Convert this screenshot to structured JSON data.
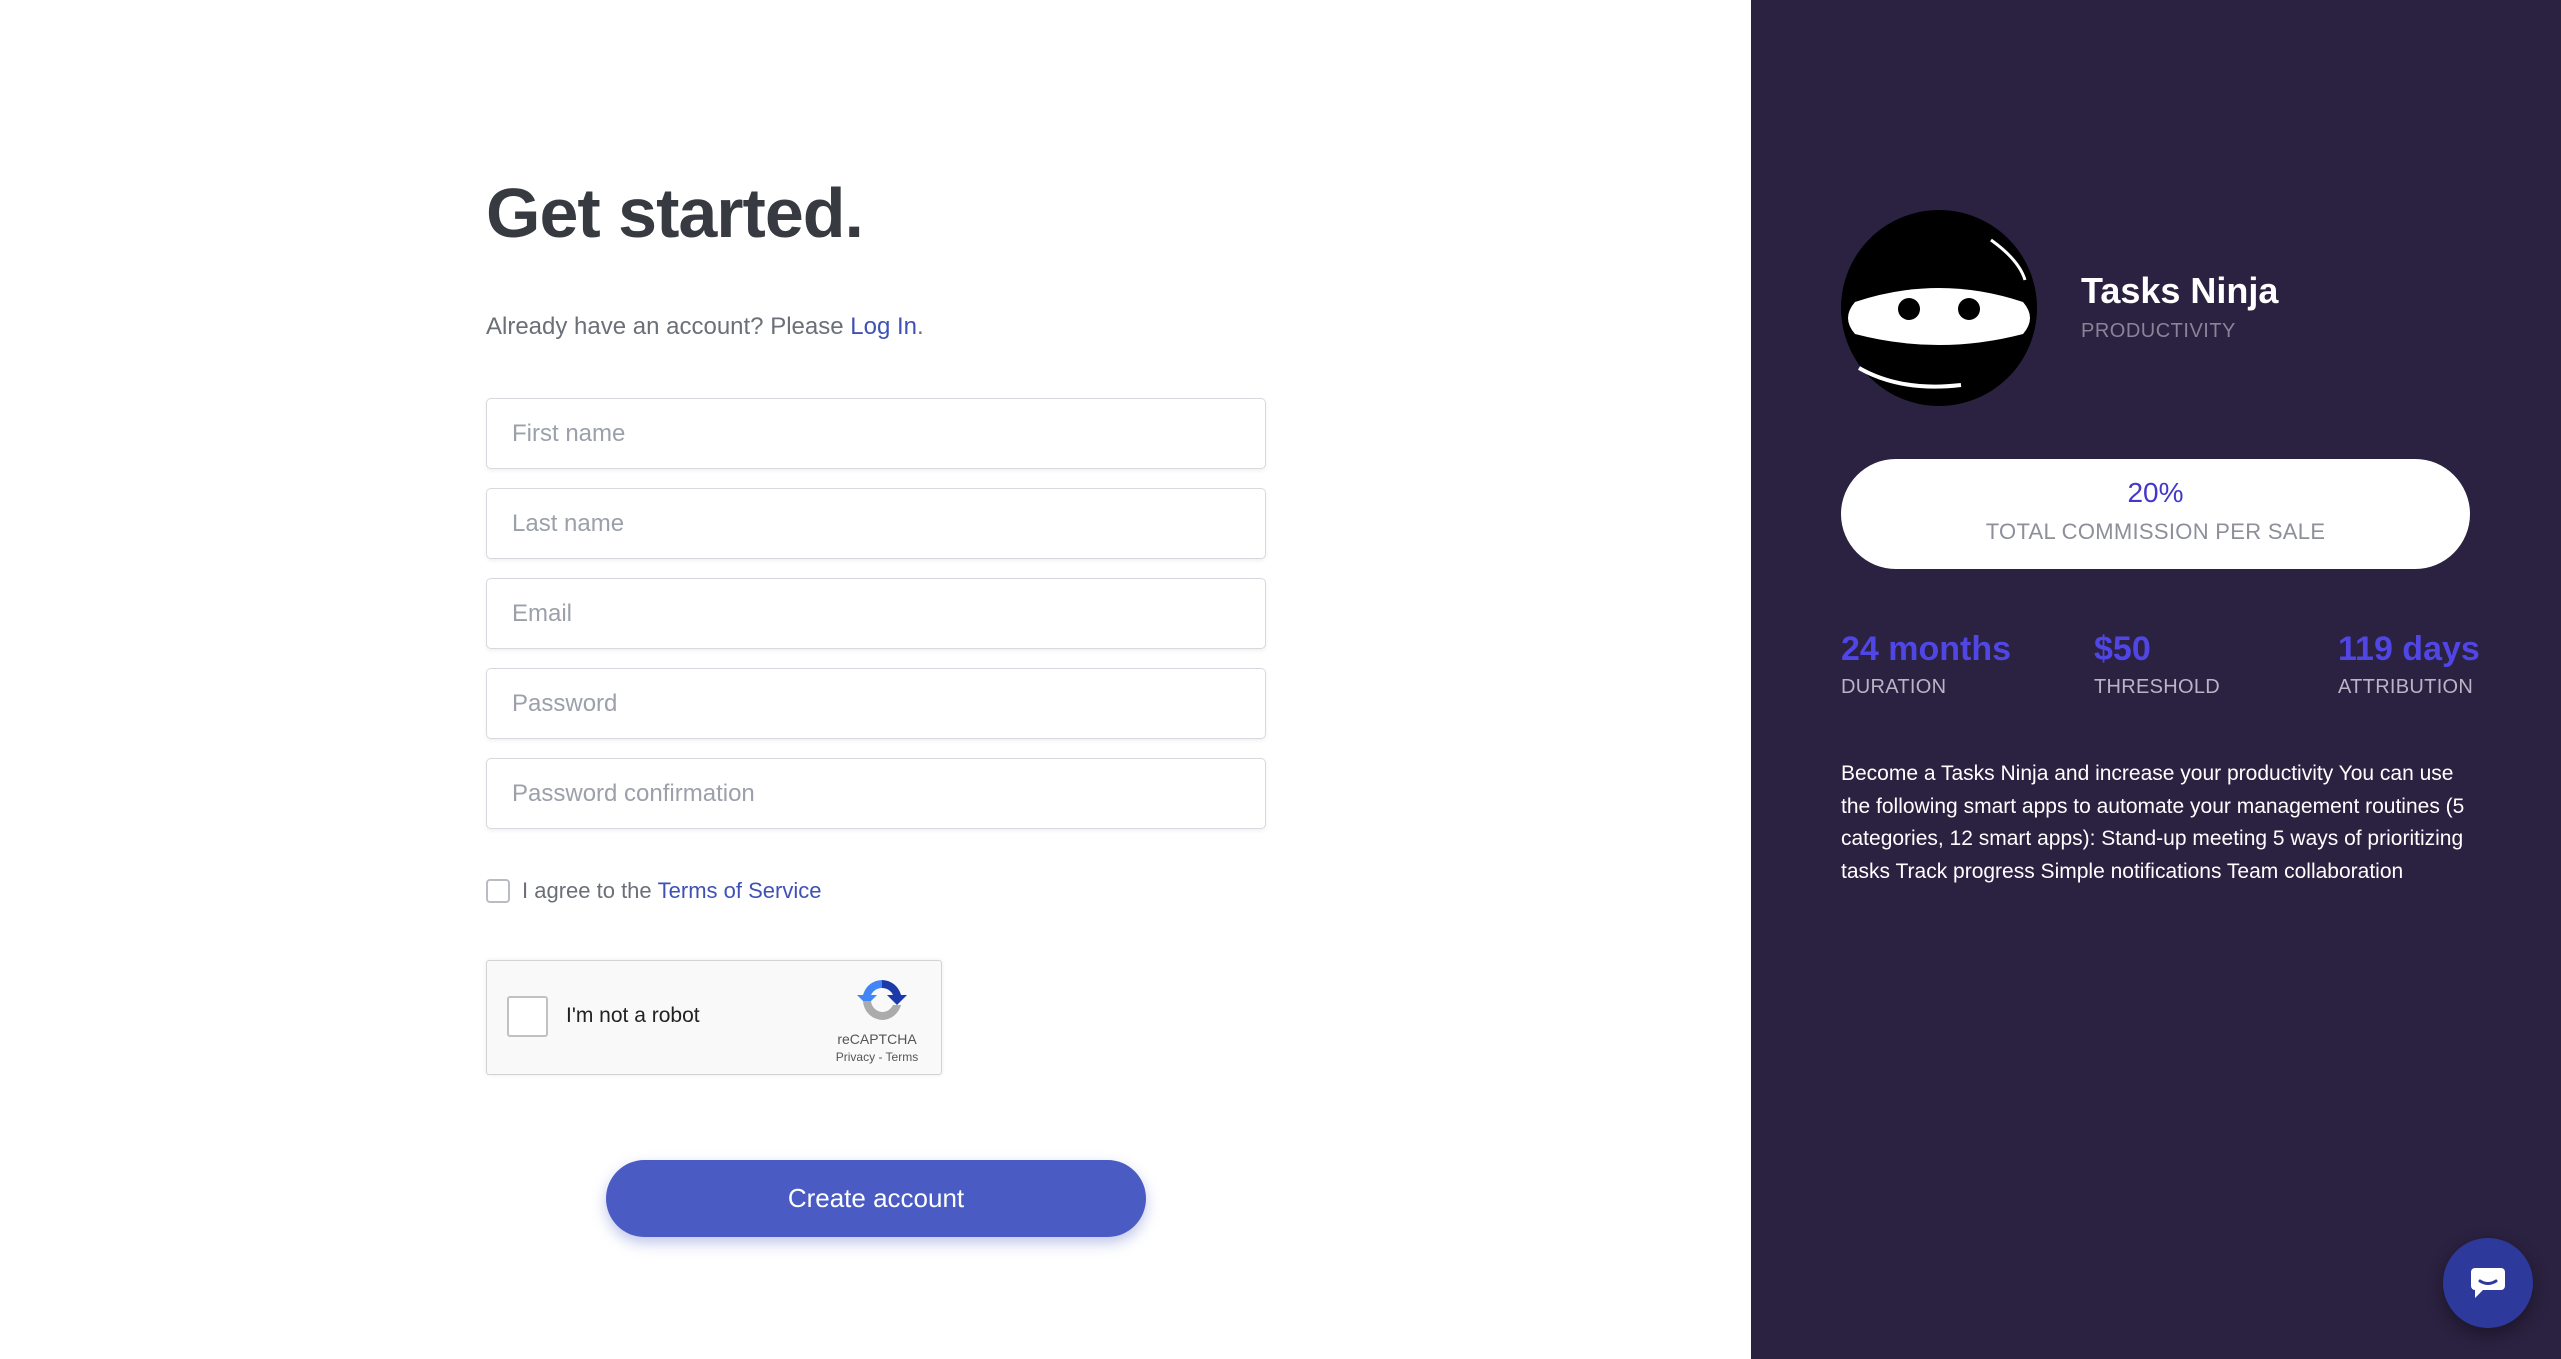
{
  "signup": {
    "title": "Get started.",
    "login_prompt": "Already have an account? Please",
    "login_link": "Log In",
    "login_suffix": ".",
    "fields": {
      "first_name_placeholder": "First name",
      "last_name_placeholder": "Last name",
      "email_placeholder": "Email",
      "password_placeholder": "Password",
      "password_confirmation_placeholder": "Password confirmation"
    },
    "terms_prefix": "I agree to the",
    "terms_link": "Terms of Service",
    "recaptcha": {
      "label": "I'm not a robot",
      "brand": "reCAPTCHA",
      "links": "Privacy - Terms"
    },
    "submit_label": "Create account"
  },
  "program": {
    "name": "Tasks Ninja",
    "category": "PRODUCTIVITY",
    "commission_value": "20%",
    "commission_label": "TOTAL COMMISSION PER SALE",
    "stats": [
      {
        "value": "24 months",
        "label": "DURATION"
      },
      {
        "value": "$50",
        "label": "THRESHOLD"
      },
      {
        "value": "119 days",
        "label": "ATTRIBUTION"
      }
    ],
    "description": "Become a Tasks Ninja and increase your productivity You can use the following smart apps to automate your management routines (5 categories, 12 smart apps): Stand-up meeting 5 ways of prioritizing tasks Track progress Simple notifications Team collaboration"
  },
  "icons": {
    "logo": "ninja-logo-icon",
    "chat": "chat-bubble-icon",
    "recaptcha": "recaptcha-logo-icon"
  },
  "colors": {
    "panel_bg": "#2b2140",
    "accent": "#4a5bc4",
    "stat_accent": "#5046e5",
    "link": "#3f51b5"
  }
}
